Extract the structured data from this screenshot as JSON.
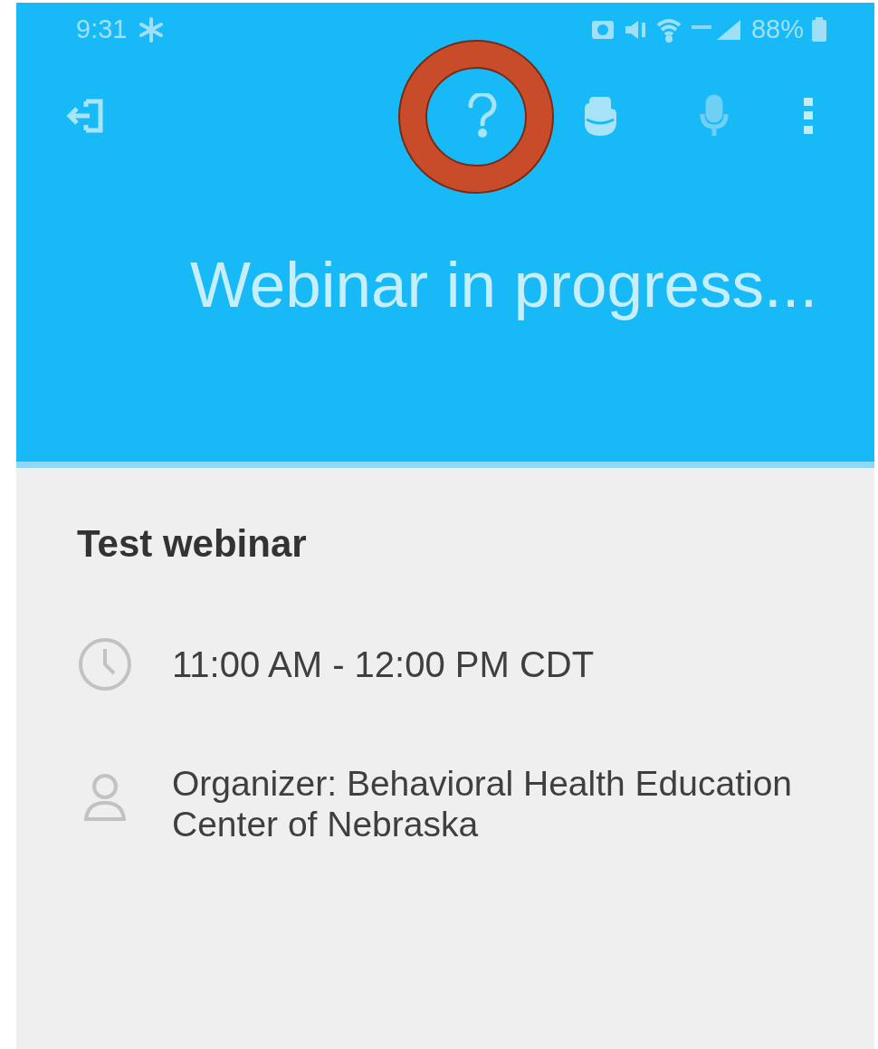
{
  "status_bar": {
    "time": "9:31",
    "battery": "88%"
  },
  "header": {
    "title": "Webinar in progress..."
  },
  "webinar": {
    "name": "Test webinar",
    "time": "11:00 AM - 12:00 PM CDT",
    "organizer": "Organizer: Behavioral Health Education Center of Nebraska"
  }
}
